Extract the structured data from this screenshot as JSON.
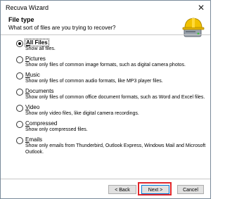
{
  "window": {
    "title": "Recuva Wizard",
    "close_glyph": "✕"
  },
  "header": {
    "title": "File type",
    "subtitle": "What sort of files are you trying to recover?"
  },
  "options": [
    {
      "key": "A",
      "label_rest": "ll Files",
      "desc": "Show all files.",
      "checked": true
    },
    {
      "key": "P",
      "label_rest": "ictures",
      "desc": "Show only files of common image formats, such as digital camera photos.",
      "checked": false
    },
    {
      "key": "M",
      "label_rest": "usic",
      "desc": "Show only files of common audio formats, like MP3 player files.",
      "checked": false
    },
    {
      "key": "D",
      "label_rest": "ocuments",
      "desc": "Show only files of common office document formats, such as Word and Excel files.",
      "checked": false
    },
    {
      "key": "V",
      "label_rest": "ideo",
      "desc": "Show only video files, like digital camera recordings.",
      "checked": false
    },
    {
      "key": "C",
      "label_rest": "ompressed",
      "desc": "Show only compressed files.",
      "checked": false
    },
    {
      "key": "E",
      "label_rest": "mails",
      "desc": "Show only emails from Thunderbird, Outlook Express, Windows Mail and Microsoft Outlook.",
      "checked": false
    }
  ],
  "buttons": {
    "back": "< Back",
    "next": "Next >",
    "cancel": "Cancel"
  },
  "colors": {
    "highlight": "#e0262b",
    "accent": "#0078d7"
  },
  "icons": {
    "logo": "recuva-hardhat-drive-icon",
    "close": "close-icon"
  }
}
